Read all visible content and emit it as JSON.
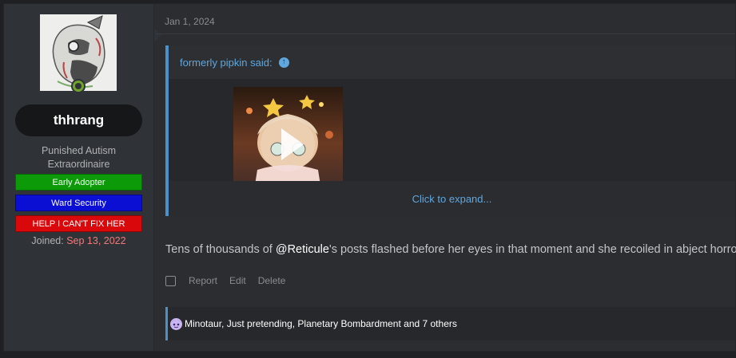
{
  "user": {
    "username": "thhrang",
    "title": "Punished Autism Extraordinaire",
    "banners": [
      {
        "label": "Early Adopter",
        "color": "#0c9a09"
      },
      {
        "label": "Ward Security",
        "color": "#0b0fd4"
      },
      {
        "label": "HELP I CAN'T FIX HER",
        "color": "#d9080b"
      }
    ],
    "joined_label": "Joined:",
    "joined_date": "Sep 13, 2022"
  },
  "post": {
    "date": "Jan 1, 2024",
    "quote": {
      "author_label": "formerly pipkin said:",
      "up_icon": "arrow-up-circle-icon",
      "media_icon": "play-icon",
      "expand_label": "Click to expand..."
    },
    "body_prefix": "Tens of thousands of ",
    "body_mention": "@Reticule",
    "body_suffix": "'s posts flashed before her eyes in that moment and she recoiled in abject horror.",
    "actions": {
      "report": "Report",
      "edit": "Edit",
      "delete": "Delete"
    },
    "reactions": {
      "icon": "reaction-icon",
      "text": "Minotaur, Just pretending, Planetary Bombardment and 7 others"
    }
  },
  "colors": {
    "accent": "#4a90c9",
    "link": "#5fa7de",
    "joined_date": "#f07a7a"
  }
}
